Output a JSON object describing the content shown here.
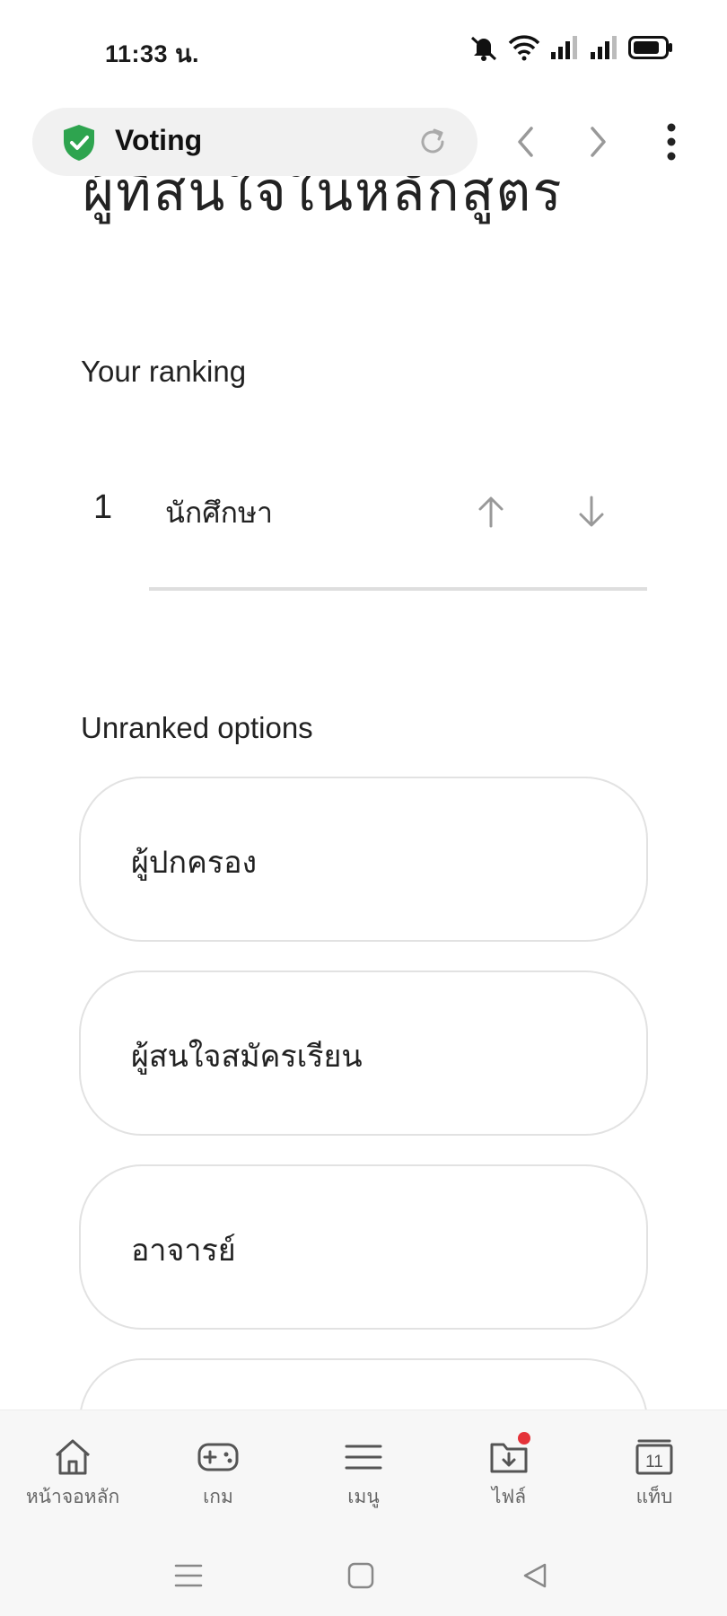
{
  "status": {
    "time": "11:33 น."
  },
  "browser": {
    "title": "Voting"
  },
  "page": {
    "heading_partial": "ผู้ที่สนใจในหลักสูตร",
    "ranking_label": "Your ranking",
    "ranked": [
      {
        "rank": "1",
        "label": "นักศึกษา"
      }
    ],
    "unranked_label": "Unranked options",
    "unranked": [
      {
        "label": "ผู้ปกครอง"
      },
      {
        "label": "ผู้สนใจสมัครเรียน"
      },
      {
        "label": "อาจารย์"
      },
      {
        "label": ""
      }
    ]
  },
  "bottom_nav": {
    "items": [
      {
        "label": "หน้าจอหลัก",
        "icon": "home-icon"
      },
      {
        "label": "เกม",
        "icon": "gamepad-icon"
      },
      {
        "label": "เมนู",
        "icon": "menu-icon"
      },
      {
        "label": "ไฟล์",
        "icon": "download-folder-icon"
      },
      {
        "label": "แท็บ",
        "icon": "tabs-icon",
        "count": "11"
      }
    ]
  },
  "colors": {
    "shield": "#2ea44f",
    "notification_dot": "#e5333a"
  }
}
